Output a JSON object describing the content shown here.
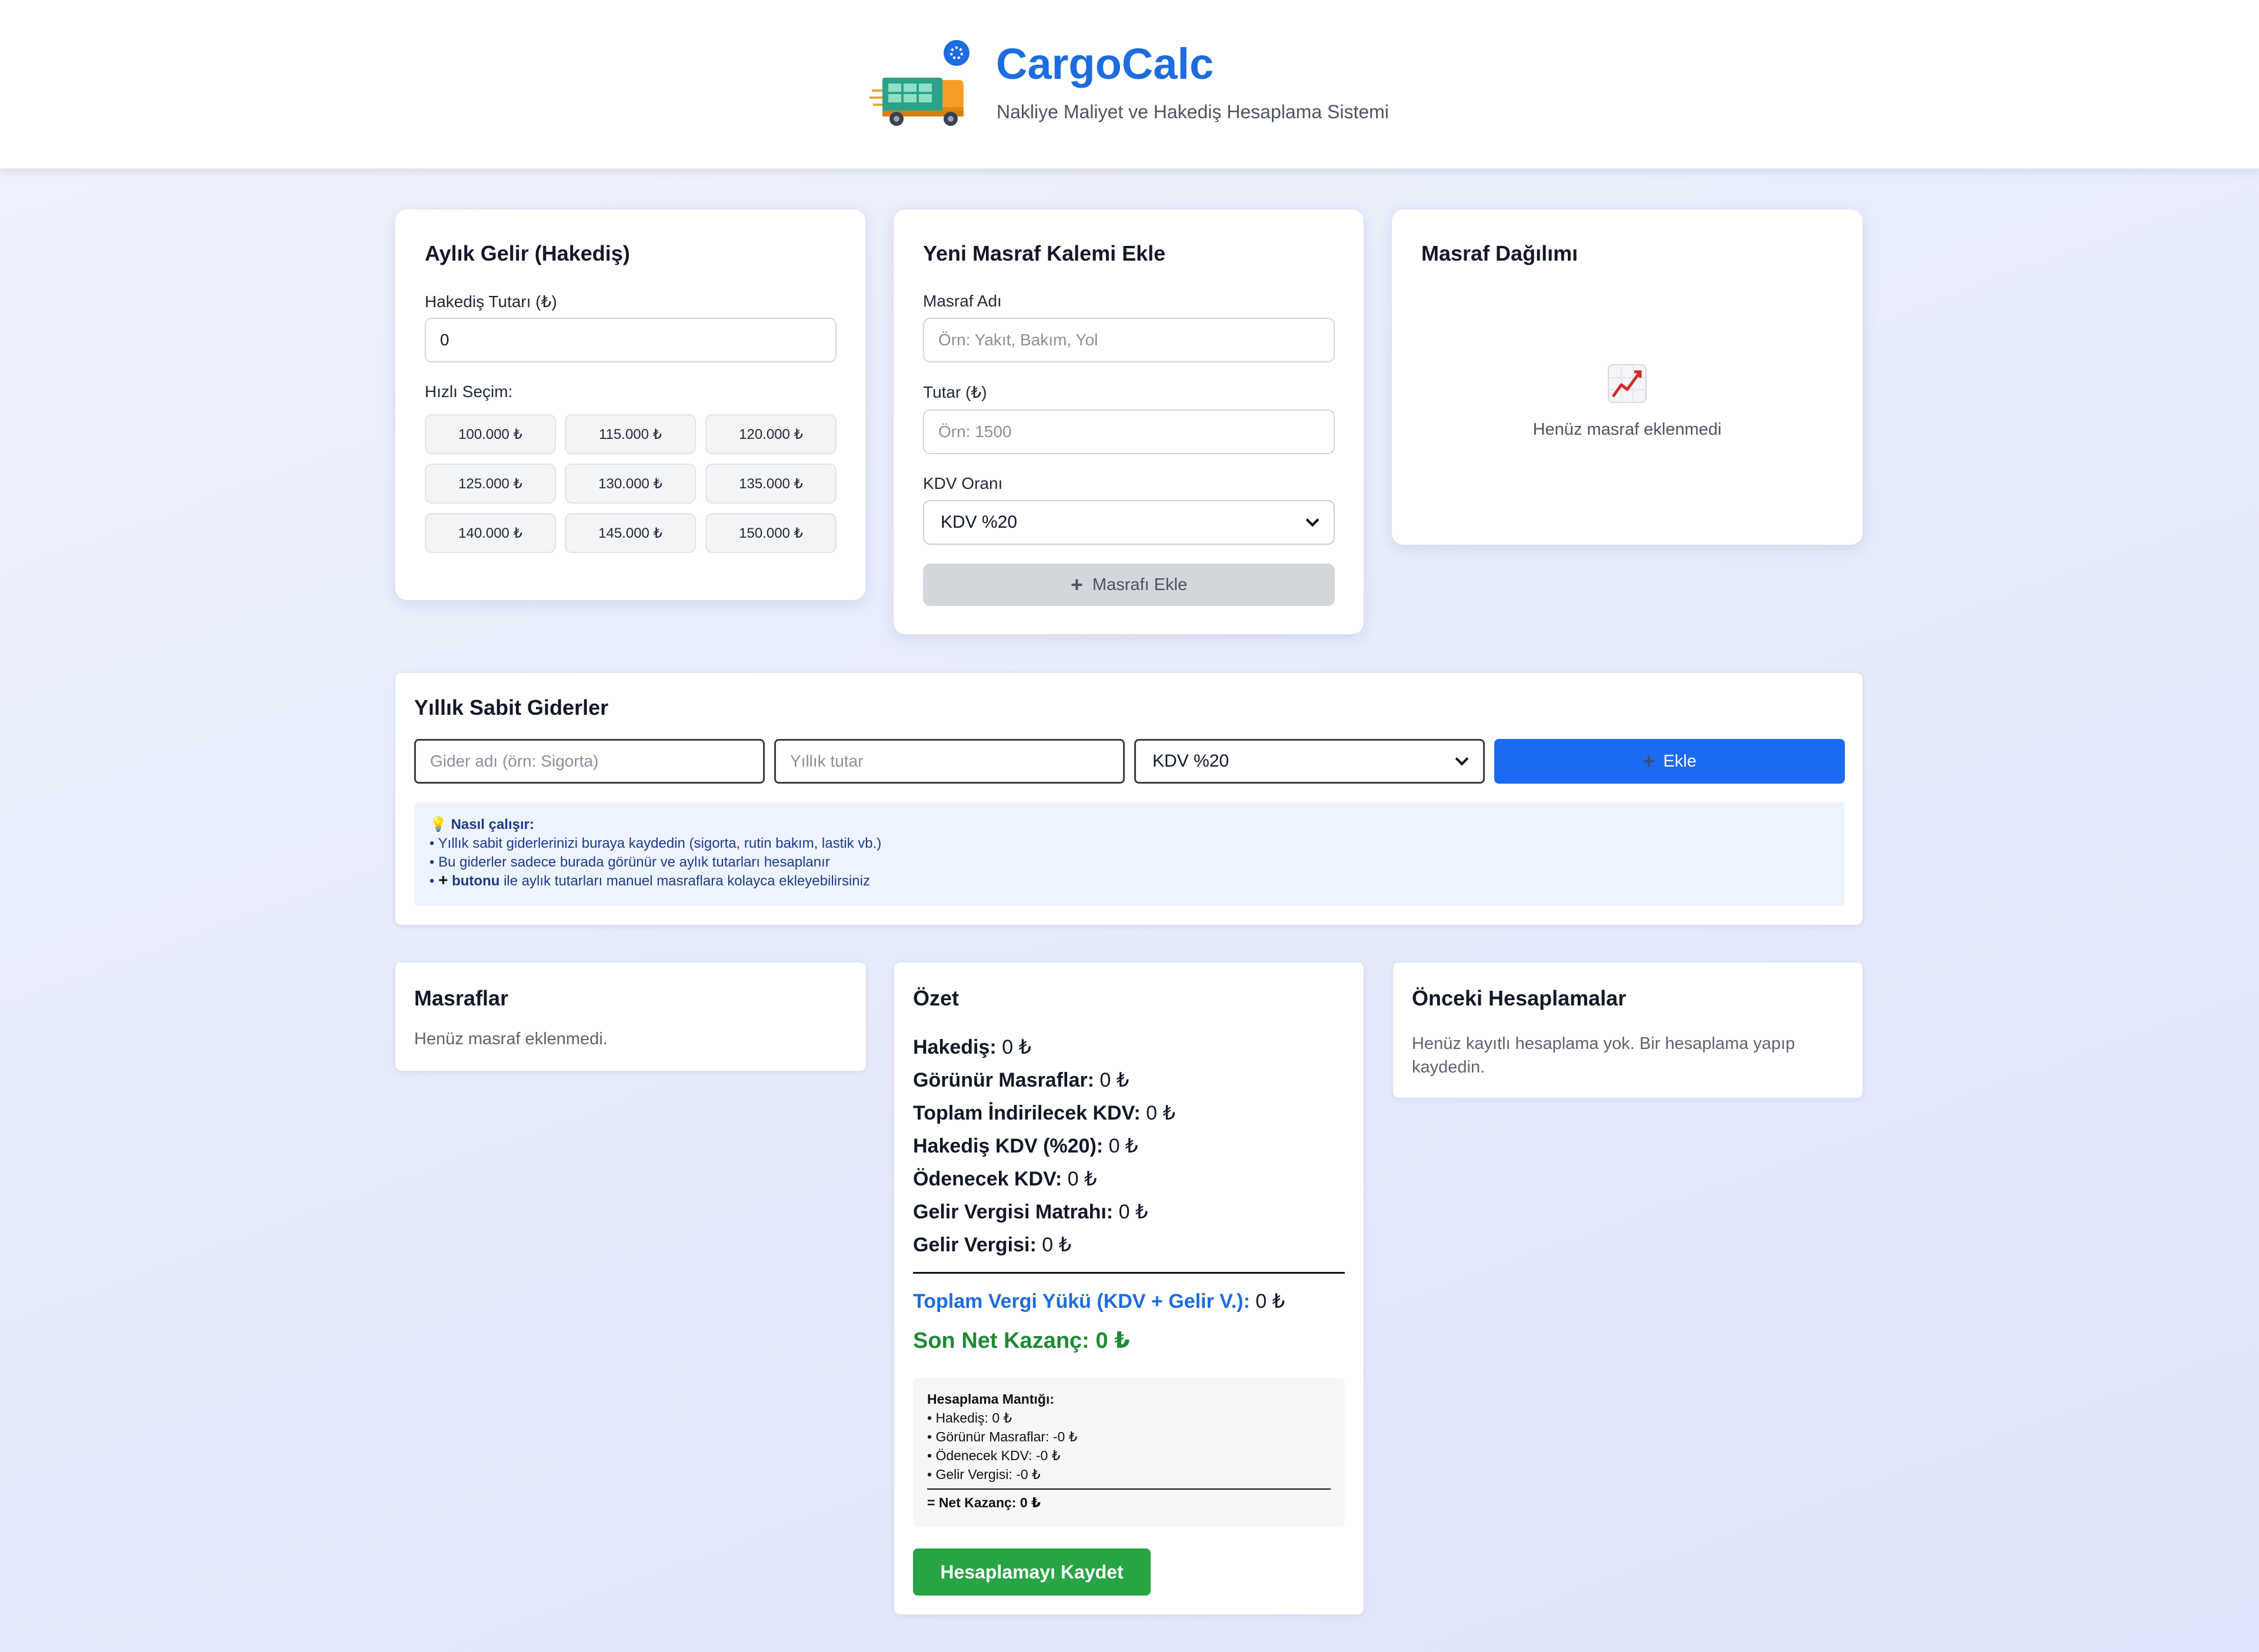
{
  "header": {
    "title": "CargoCalc",
    "subtitle": "Nakliye Maliyet ve Hakediş Hesaplama Sistemi",
    "logo_icon": "delivery-truck-icon"
  },
  "income_card": {
    "title": "Aylık Gelir (Hakediş)",
    "amount_label": "Hakediş Tutarı (₺)",
    "amount_value": "0",
    "quick_label": "Hızlı Seçim:",
    "quick_options": [
      "100.000 ₺",
      "115.000 ₺",
      "120.000 ₺",
      "125.000 ₺",
      "130.000 ₺",
      "135.000 ₺",
      "140.000 ₺",
      "145.000 ₺",
      "150.000 ₺"
    ]
  },
  "expense_form": {
    "title": "Yeni Masraf Kalemi Ekle",
    "name_label": "Masraf Adı",
    "name_placeholder": "Örn: Yakıt, Bakım, Yol",
    "amount_label": "Tutar (₺)",
    "amount_placeholder": "Örn: 1500",
    "vat_label": "KDV Oranı",
    "vat_selected": "KDV %20",
    "add_button": "Masrafı Ekle"
  },
  "distribution_card": {
    "title": "Masraf Dağılımı",
    "empty_icon": "chart-increasing-icon",
    "empty_text": "Henüz masraf eklenmedi"
  },
  "fixed_expenses": {
    "title": "Yıllık Sabit Giderler",
    "name_placeholder": "Gider adı (örn: Sigorta)",
    "amount_placeholder": "Yıllık tutar",
    "vat_selected": "KDV %20",
    "add_button": "Ekle",
    "info_title": "Nasıl çalışır:",
    "info_lines": [
      "• Yıllık sabit giderlerinizi buraya kaydedin (sigorta, rutin bakım, lastik vb.)",
      "• Bu giderler sadece burada görünür ve aylık tutarları hesaplanır"
    ],
    "info_line3_bold": "butonu",
    "info_line3_rest": "ile aylık tutarları manuel masraflara kolayca ekleyebilirsiniz"
  },
  "expenses_card": {
    "title": "Masraflar",
    "empty_text": "Henüz masraf eklenmedi."
  },
  "summary": {
    "title": "Özet",
    "rows": [
      {
        "label": "Hakediş:",
        "value": "0 ₺"
      },
      {
        "label": "Görünür Masraflar:",
        "value": "0 ₺"
      },
      {
        "label": "Toplam İndirilecek KDV:",
        "value": "0 ₺"
      },
      {
        "label": "Hakediş KDV (%20):",
        "value": "0 ₺"
      },
      {
        "label": "Ödenecek KDV:",
        "value": "0 ₺"
      },
      {
        "label": "Gelir Vergisi Matrahı:",
        "value": "0 ₺"
      },
      {
        "label": "Gelir Vergisi:",
        "value": "0 ₺"
      }
    ],
    "tax_total_label": "Toplam Vergi Yükü (KDV + Gelir V.):",
    "tax_total_value": "0 ₺",
    "net_label": "Son Net Kazanç:",
    "net_value": "0 ₺",
    "logic_title": "Hesaplama Mantığı:",
    "logic_lines": [
      "• Hakediş: 0 ₺",
      "• Görünür Masraflar: -0 ₺",
      "• Ödenecek KDV: -0 ₺",
      "• Gelir Vergisi: -0 ₺"
    ],
    "logic_result": "= Net Kazanç: 0 ₺",
    "save_button": "Hesaplamayı Kaydet",
    "colors": {
      "tax_total": "#1d6ce0",
      "net": "#1f8a34",
      "save_button": "#27a444"
    }
  },
  "history": {
    "title": "Önceki Hesaplamalar",
    "empty_text": "Henüz kayıtlı hesaplama yok. Bir hesaplama yapıp kaydedin."
  }
}
